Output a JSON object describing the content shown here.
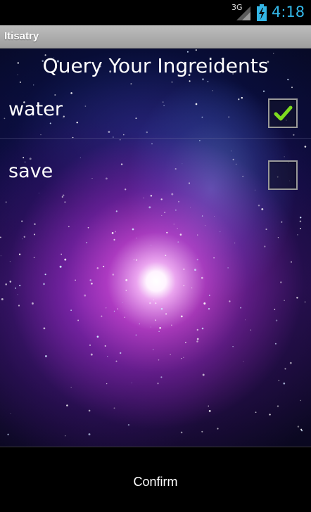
{
  "status_bar": {
    "network": "3G",
    "time": "4:18",
    "accent_color": "#33b5e5",
    "signal_icon": "signal-strength-icon",
    "battery_icon": "battery-charging-icon"
  },
  "title_bar": {
    "title": "Itisatry"
  },
  "main": {
    "heading": "Query Your Ingreidents",
    "ingredients": [
      {
        "label": "water",
        "checked": true
      },
      {
        "label": "save",
        "checked": false
      }
    ]
  },
  "footer": {
    "confirm_label": "Confirm"
  },
  "colors": {
    "checkmark": "#7ddc1f",
    "title_bar": "#a8a8a8"
  }
}
